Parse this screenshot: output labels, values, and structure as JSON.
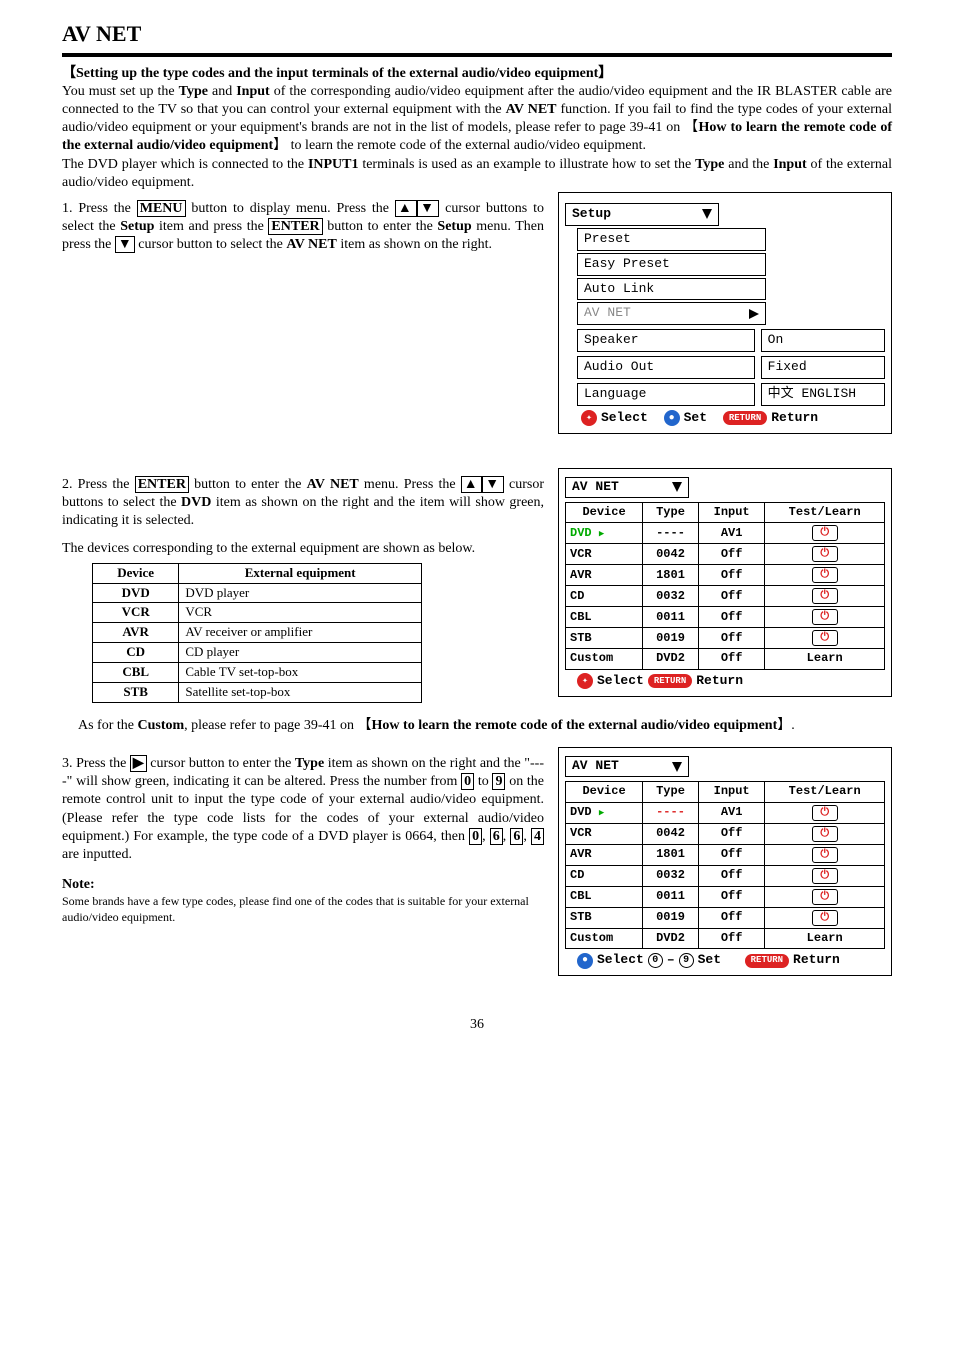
{
  "title": "AV NET",
  "section_heading": "【Setting up the type codes and the input terminals of the external audio/video equipment】",
  "intro": "You must set up the Type and Input of the corresponding audio/video equipment after the audio/video equipment and the IR BLASTER cable are connected to the TV so that you can control your external equipment with the AV NET function. If you fail to find the type codes of your external audio/video equipment or your equipment's brands are not in the list of models, please refer to page 39-41 on 【How to learn the remote code of the external audio/video equipment】 to learn the remote code of the external audio/video equipment.",
  "intro2": "The DVD player which is connected to the INPUT1 terminals is used as an example to illustrate how to set the Type and the Input of the external audio/video equipment.",
  "step1": "1. Press the MENU button to display menu. Press the ▲ ▼ cursor buttons to select the Setup item and press the ENTER button to enter the Setup menu. Then press the ▼ cursor button to select the AV NET item as shown on the right.",
  "step2_a": "2. Press the ENTER button to enter the AV NET menu. Press the ▲ ▼ cursor buttons to select the DVD item as shown on the right and the item will show green, indicating it is selected.",
  "step2_b": "The devices corresponding to the external equipment are shown as below.",
  "device_table": {
    "headers": [
      "Device",
      "External equipment"
    ],
    "rows": [
      [
        "DVD",
        "DVD player"
      ],
      [
        "VCR",
        "VCR"
      ],
      [
        "AVR",
        "AV receiver or amplifier"
      ],
      [
        "CD",
        "CD player"
      ],
      [
        "CBL",
        "Cable TV set-top-box"
      ],
      [
        "STB",
        "Satellite set-top-box"
      ]
    ]
  },
  "custom_note": "As for the Custom, please refer to page 39-41 on 【How to learn the remote code of the external audio/video equipment】.",
  "step3": "3. Press the ▶ cursor button to enter the Type item as shown on the right and the \"----\" will show green, indicating it can be altered. Press the number from 0 to 9 on the remote control unit to input the type code of your external audio/video equipment. (Please refer the type code lists for the codes of your external audio/video equipment.) For example, the type code of a DVD player is 0664, then 0, 6, 6, 4 are inputted.",
  "note_head": "Note:",
  "note_body": "Some brands have a few type codes, please find one of the codes that is suitable for your external audio/video equipment.",
  "setup_menu": {
    "title": "Setup",
    "items": [
      {
        "label": "Preset"
      },
      {
        "label": "Easy Preset"
      },
      {
        "label": "Auto Link"
      },
      {
        "label": "AV NET",
        "greyed": true,
        "arrow_right": true
      },
      {
        "label": "Speaker",
        "value": "On"
      },
      {
        "label": "Audio Out",
        "value": "Fixed"
      },
      {
        "label": "Language",
        "value": "中文  ENGLISH"
      }
    ],
    "footer_select": "Select",
    "footer_set": "Set",
    "footer_return": "Return",
    "return_pill": "RETURN"
  },
  "avnet_menu1": {
    "title": "AV NET",
    "headers": [
      "Device",
      "Type",
      "Input",
      "Test/Learn"
    ],
    "rows": [
      {
        "device": "DVD",
        "type": "----",
        "input": "AV1",
        "tl": "power",
        "hl_device": true
      },
      {
        "device": "VCR",
        "type": "0042",
        "input": "Off",
        "tl": "power"
      },
      {
        "device": "AVR",
        "type": "1801",
        "input": "Off",
        "tl": "power"
      },
      {
        "device": "CD",
        "type": "0032",
        "input": "Off",
        "tl": "power"
      },
      {
        "device": "CBL",
        "type": "0011",
        "input": "Off",
        "tl": "power"
      },
      {
        "device": "STB",
        "type": "0019",
        "input": "Off",
        "tl": "power"
      },
      {
        "device": "Custom",
        "type": "DVD2",
        "input": "Off",
        "tl_text": "Learn"
      }
    ],
    "footer_select": "Select",
    "footer_return": "Return",
    "return_pill": "RETURN"
  },
  "avnet_menu2": {
    "title": "AV NET",
    "headers": [
      "Device",
      "Type",
      "Input",
      "Test/Learn"
    ],
    "rows": [
      {
        "device": "DVD",
        "type": "----",
        "input": "AV1",
        "tl": "power",
        "hl_type": true
      },
      {
        "device": "VCR",
        "type": "0042",
        "input": "Off",
        "tl": "power"
      },
      {
        "device": "AVR",
        "type": "1801",
        "input": "Off",
        "tl": "power"
      },
      {
        "device": "CD",
        "type": "0032",
        "input": "Off",
        "tl": "power"
      },
      {
        "device": "CBL",
        "type": "0011",
        "input": "Off",
        "tl": "power"
      },
      {
        "device": "STB",
        "type": "0019",
        "input": "Off",
        "tl": "power"
      },
      {
        "device": "Custom",
        "type": "DVD2",
        "input": "Off",
        "tl_text": "Learn"
      }
    ],
    "footer_select_prefix": "Select",
    "footer_set": "Set",
    "footer_return": "Return",
    "return_pill": "RETURN",
    "circ0": "0",
    "circ9": "9"
  },
  "page_number": "36"
}
